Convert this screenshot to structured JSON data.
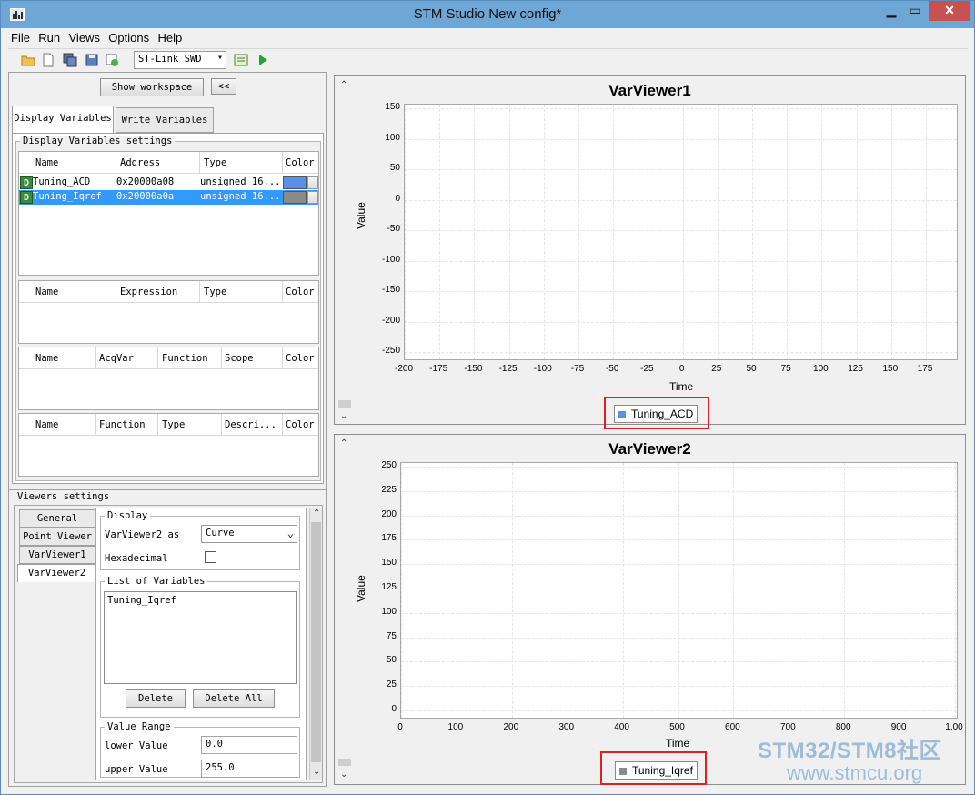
{
  "window": {
    "title": "STM Studio New config*"
  },
  "menu": [
    "File",
    "Run",
    "Views",
    "Options",
    "Help"
  ],
  "toolbar": {
    "probe": "ST-Link SWD",
    "icons": [
      "open-folder-icon",
      "new-file-icon",
      "save-all-icon",
      "save-icon",
      "export-icon",
      "settings-icon",
      "run-icon"
    ]
  },
  "left": {
    "show_workspace": "Show workspace",
    "collapse": "<<",
    "tabs": [
      "Display Variables",
      "Write Variables"
    ],
    "settings_title": "Display Variables settings",
    "vars_table": {
      "headers": [
        "Name",
        "Address",
        "Type",
        "Color"
      ],
      "rows": [
        {
          "badge": "D",
          "name": "Tuning_ACD",
          "address": "0x20000a08",
          "type": "unsigned 16...",
          "color": "#5b8fe6"
        },
        {
          "badge": "D",
          "name": "Tuning_Iqref",
          "address": "0x20000a0a",
          "type": "unsigned 16...",
          "color": "#8a8a8a"
        }
      ]
    },
    "expr_table": {
      "headers": [
        "Name",
        "Expression",
        "Type",
        "Color"
      ]
    },
    "acq_table": {
      "headers": [
        "Name",
        "AcqVar",
        "Function",
        "Scope",
        "Color"
      ]
    },
    "func_table": {
      "headers": [
        "Name",
        "Function",
        "Type",
        "Descri...",
        "Color"
      ]
    },
    "viewers_title": "Viewers settings",
    "viewer_tabs": [
      "General",
      "Point Viewer",
      "VarViewer1",
      "VarViewer2"
    ],
    "display": {
      "title": "Display",
      "as_label": "VarViewer2 as",
      "as_value": "Curve",
      "hex_label": "Hexadecimal"
    },
    "list": {
      "title": "List of Variables",
      "items": [
        "Tuning_Iqref"
      ],
      "delete": "Delete",
      "delete_all": "Delete All"
    },
    "range": {
      "title": "Value Range",
      "lower_label": "lower Value",
      "lower_value": "0.0",
      "upper_label": "upper Value",
      "upper_value": "255.0"
    }
  },
  "viewers": [
    {
      "title": "VarViewer1",
      "ylabel": "Value",
      "xlabel": "Time",
      "yticks": [
        "150",
        "100",
        "50",
        "0",
        "-50",
        "-100",
        "-150",
        "-200",
        "-250"
      ],
      "xticks": [
        "-200",
        "-175",
        "-150",
        "-125",
        "-100",
        "-75",
        "-50",
        "-25",
        "0",
        "25",
        "50",
        "75",
        "100",
        "125",
        "150",
        "175"
      ],
      "legend": "Tuning_ACD",
      "legend_color": "#5b8fe6"
    },
    {
      "title": "VarViewer2",
      "ylabel": "Value",
      "xlabel": "Time",
      "yticks": [
        "250",
        "225",
        "200",
        "175",
        "150",
        "125",
        "100",
        "75",
        "50",
        "25",
        "0"
      ],
      "xticks": [
        "0",
        "100",
        "200",
        "300",
        "400",
        "500",
        "600",
        "700",
        "800",
        "900",
        "1,00"
      ],
      "legend": "Tuning_Iqref",
      "legend_color": "#8a8a8a"
    }
  ],
  "watermark": {
    "line1": "STM32/STM8社区",
    "line2": "www.stmcu.org"
  }
}
